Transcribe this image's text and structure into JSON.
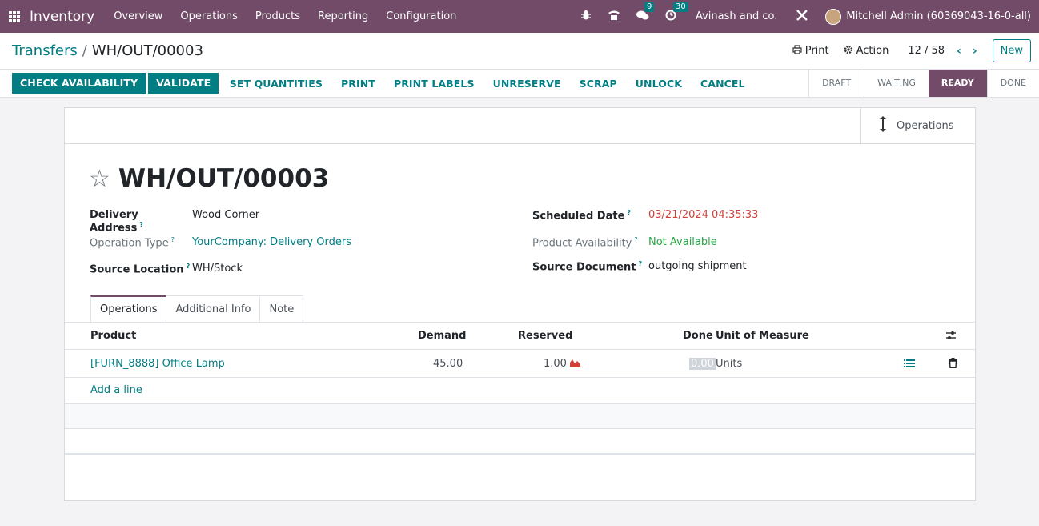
{
  "navbar": {
    "brand": "Inventory",
    "menu": [
      "Overview",
      "Operations",
      "Products",
      "Reporting",
      "Configuration"
    ],
    "messages_count": "9",
    "activities_count": "30",
    "company": "Avinash and co.",
    "user": "Mitchell Admin (60369043-16-0-all)"
  },
  "control": {
    "breadcrumb_parent": "Transfers",
    "breadcrumb_sep": "/",
    "breadcrumb_current": "WH/OUT/00003",
    "print_label": "Print",
    "action_label": "Action",
    "pager": "12 / 58",
    "new_label": "New"
  },
  "statusbar": {
    "buttons": [
      "CHECK AVAILABILITY",
      "VALIDATE",
      "SET QUANTITIES",
      "PRINT",
      "PRINT LABELS",
      "UNRESERVE",
      "SCRAP",
      "UNLOCK",
      "CANCEL"
    ],
    "stages": [
      "DRAFT",
      "WAITING",
      "READY",
      "DONE"
    ],
    "active_stage": "READY"
  },
  "sheet": {
    "smart_button": "Operations",
    "title": "WH/OUT/00003",
    "left_fields": [
      {
        "label": "Delivery Address",
        "value": "Wood Corner"
      },
      {
        "label": "Operation Type",
        "value": "YourCompany: Delivery Orders"
      },
      {
        "label": "Source Location",
        "value": "WH/Stock"
      }
    ],
    "right_fields": [
      {
        "label": "Scheduled Date",
        "value": "03/21/2024 04:35:33"
      },
      {
        "label": "Product Availability",
        "value": "Not Available"
      },
      {
        "label": "Source Document",
        "value": "outgoing shipment"
      }
    ],
    "help_mark": "?",
    "tabs": [
      "Operations",
      "Additional Info",
      "Note"
    ],
    "table": {
      "headers": [
        "Product",
        "Demand",
        "Reserved",
        "Done",
        "Unit of Measure"
      ],
      "rows": [
        {
          "product": "[FURN_8888] Office Lamp",
          "demand": "45.00",
          "reserved": "1.00",
          "done": "0.00",
          "uom": "Units"
        }
      ],
      "add_line": "Add a line"
    }
  },
  "colors": {
    "brand": "#714b67",
    "accent": "#017e84",
    "danger": "#d23f3a",
    "success": "#28a745"
  }
}
